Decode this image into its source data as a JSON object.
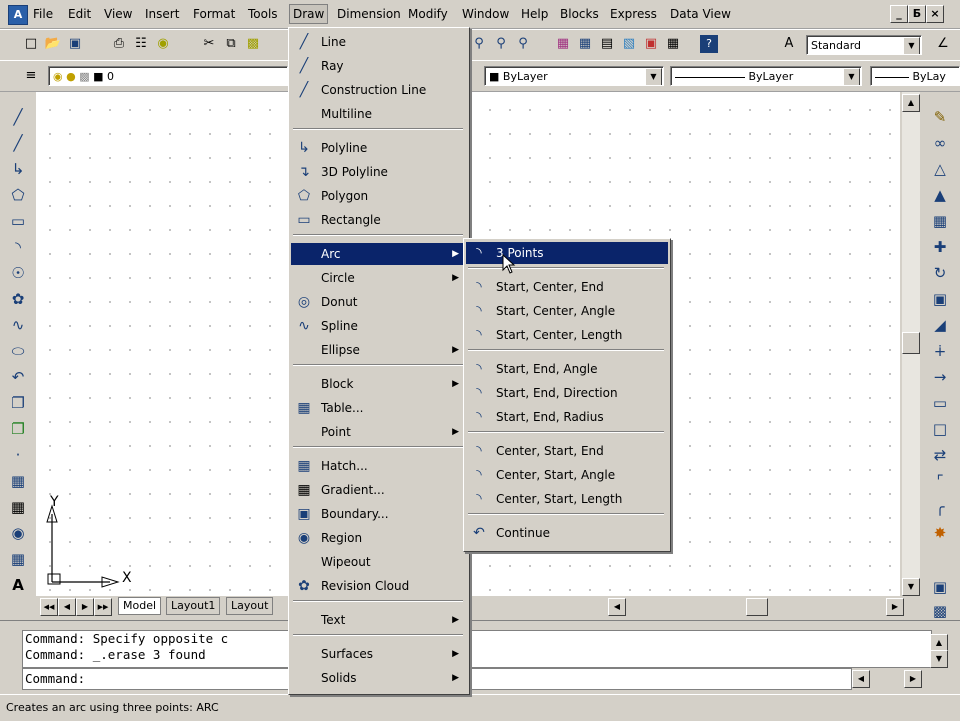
{
  "menubar": {
    "items": [
      "File",
      "Edit",
      "View",
      "Insert",
      "Format",
      "Tools",
      "Draw",
      "Dimension",
      "Modify",
      "Window",
      "Help",
      "Blocks",
      "Express",
      "Data View"
    ],
    "active": "Draw",
    "window_buttons": [
      "_",
      "Б",
      "×"
    ]
  },
  "toolbar": {
    "text_style": "Standard",
    "layer_name": "0",
    "color": "ByLayer",
    "linetype": "ByLayer",
    "lineweight": "ByLay"
  },
  "draw_menu": {
    "items": [
      {
        "label": "Line",
        "icon": "line-icon",
        "submenu": false
      },
      {
        "label": "Ray",
        "icon": "ray-icon",
        "submenu": false
      },
      {
        "label": "Construction Line",
        "icon": "construction-line-icon",
        "submenu": false
      },
      {
        "label": "Multiline",
        "icon": "",
        "submenu": false
      },
      {
        "label": "Polyline",
        "icon": "polyline-icon",
        "submenu": false
      },
      {
        "label": "3D Polyline",
        "icon": "3d-polyline-icon",
        "submenu": false
      },
      {
        "label": "Polygon",
        "icon": "polygon-icon",
        "submenu": false
      },
      {
        "label": "Rectangle",
        "icon": "rectangle-icon",
        "submenu": false
      },
      {
        "label": "Arc",
        "icon": "",
        "submenu": true
      },
      {
        "label": "Circle",
        "icon": "",
        "submenu": true
      },
      {
        "label": "Donut",
        "icon": "donut-icon",
        "submenu": false
      },
      {
        "label": "Spline",
        "icon": "spline-icon",
        "submenu": false
      },
      {
        "label": "Ellipse",
        "icon": "",
        "submenu": true
      },
      {
        "label": "Block",
        "icon": "",
        "submenu": true
      },
      {
        "label": "Table...",
        "icon": "table-icon",
        "submenu": false
      },
      {
        "label": "Point",
        "icon": "",
        "submenu": true
      },
      {
        "label": "Hatch...",
        "icon": "hatch-icon",
        "submenu": false
      },
      {
        "label": "Gradient...",
        "icon": "gradient-icon",
        "submenu": false
      },
      {
        "label": "Boundary...",
        "icon": "boundary-icon",
        "submenu": false
      },
      {
        "label": "Region",
        "icon": "region-icon",
        "submenu": false
      },
      {
        "label": "Wipeout",
        "icon": "",
        "submenu": false
      },
      {
        "label": "Revision Cloud",
        "icon": "revision-cloud-icon",
        "submenu": false
      },
      {
        "label": "Text",
        "icon": "",
        "submenu": true
      },
      {
        "label": "Surfaces",
        "icon": "",
        "submenu": true
      },
      {
        "label": "Solids",
        "icon": "",
        "submenu": true
      }
    ]
  },
  "arc_menu": {
    "items": [
      "3 Points",
      "Start, Center, End",
      "Start, Center, Angle",
      "Start, Center, Length",
      "Start, End, Angle",
      "Start, End, Direction",
      "Start, End, Radius",
      "Center, Start, End",
      "Center, Start, Angle",
      "Center, Start, Length",
      "Continue"
    ],
    "highlighted": "3 Points"
  },
  "layout_tabs": [
    "Model",
    "Layout1",
    "Layout"
  ],
  "ucs": {
    "x": "X",
    "y": "Y"
  },
  "command": {
    "history": [
      "Command: Specify opposite c",
      "Command: _.erase 3 found"
    ],
    "prompt": "Command:"
  },
  "status_text": "Creates an arc using three points: ARC",
  "colors": {
    "highlight": "#0a246a",
    "chrome": "#d4d0c8",
    "canvas": "#ffffff"
  }
}
